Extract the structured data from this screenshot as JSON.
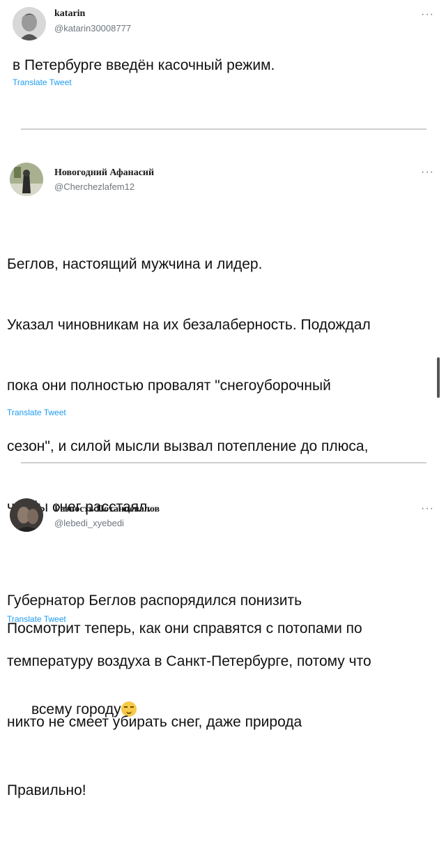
{
  "tweets": [
    {
      "name": "katarin",
      "handle": "@katarin30008777",
      "more": "···",
      "text": "в Петербурге введён касочный режим.",
      "translate": "Translate Tweet"
    },
    {
      "name": "Новогодний Афанасий",
      "handle": "@Cherchezlafem12",
      "more": "···",
      "text_lines": [
        "Беглов, настоящий мужчина и лидер.",
        "Указал чиновникам на их безалаберность. Подождал",
        "пока они полностью провалят \"снегоуборочный",
        "сезон\", и силой мысли вызвал потепление до плюса,",
        "чтобы снег расстаял.",
        "",
        "Посмотрит теперь, как они справятся с потопами по",
        "всему городу",
        "Правильно!"
      ],
      "emoji": "smirking-face",
      "translate": "Translate Tweet"
    },
    {
      "name": "Разность Потанцевалов",
      "handle": "@lebedi_xyebedi",
      "more": "···",
      "text_lines": [
        "Губернатор Беглов распорядился понизить",
        "температуру воздуха в Санкт-Петербурге, потому что",
        "никто не смеет убирать снег, даже природа"
      ],
      "translate": "Translate Tweet"
    }
  ]
}
